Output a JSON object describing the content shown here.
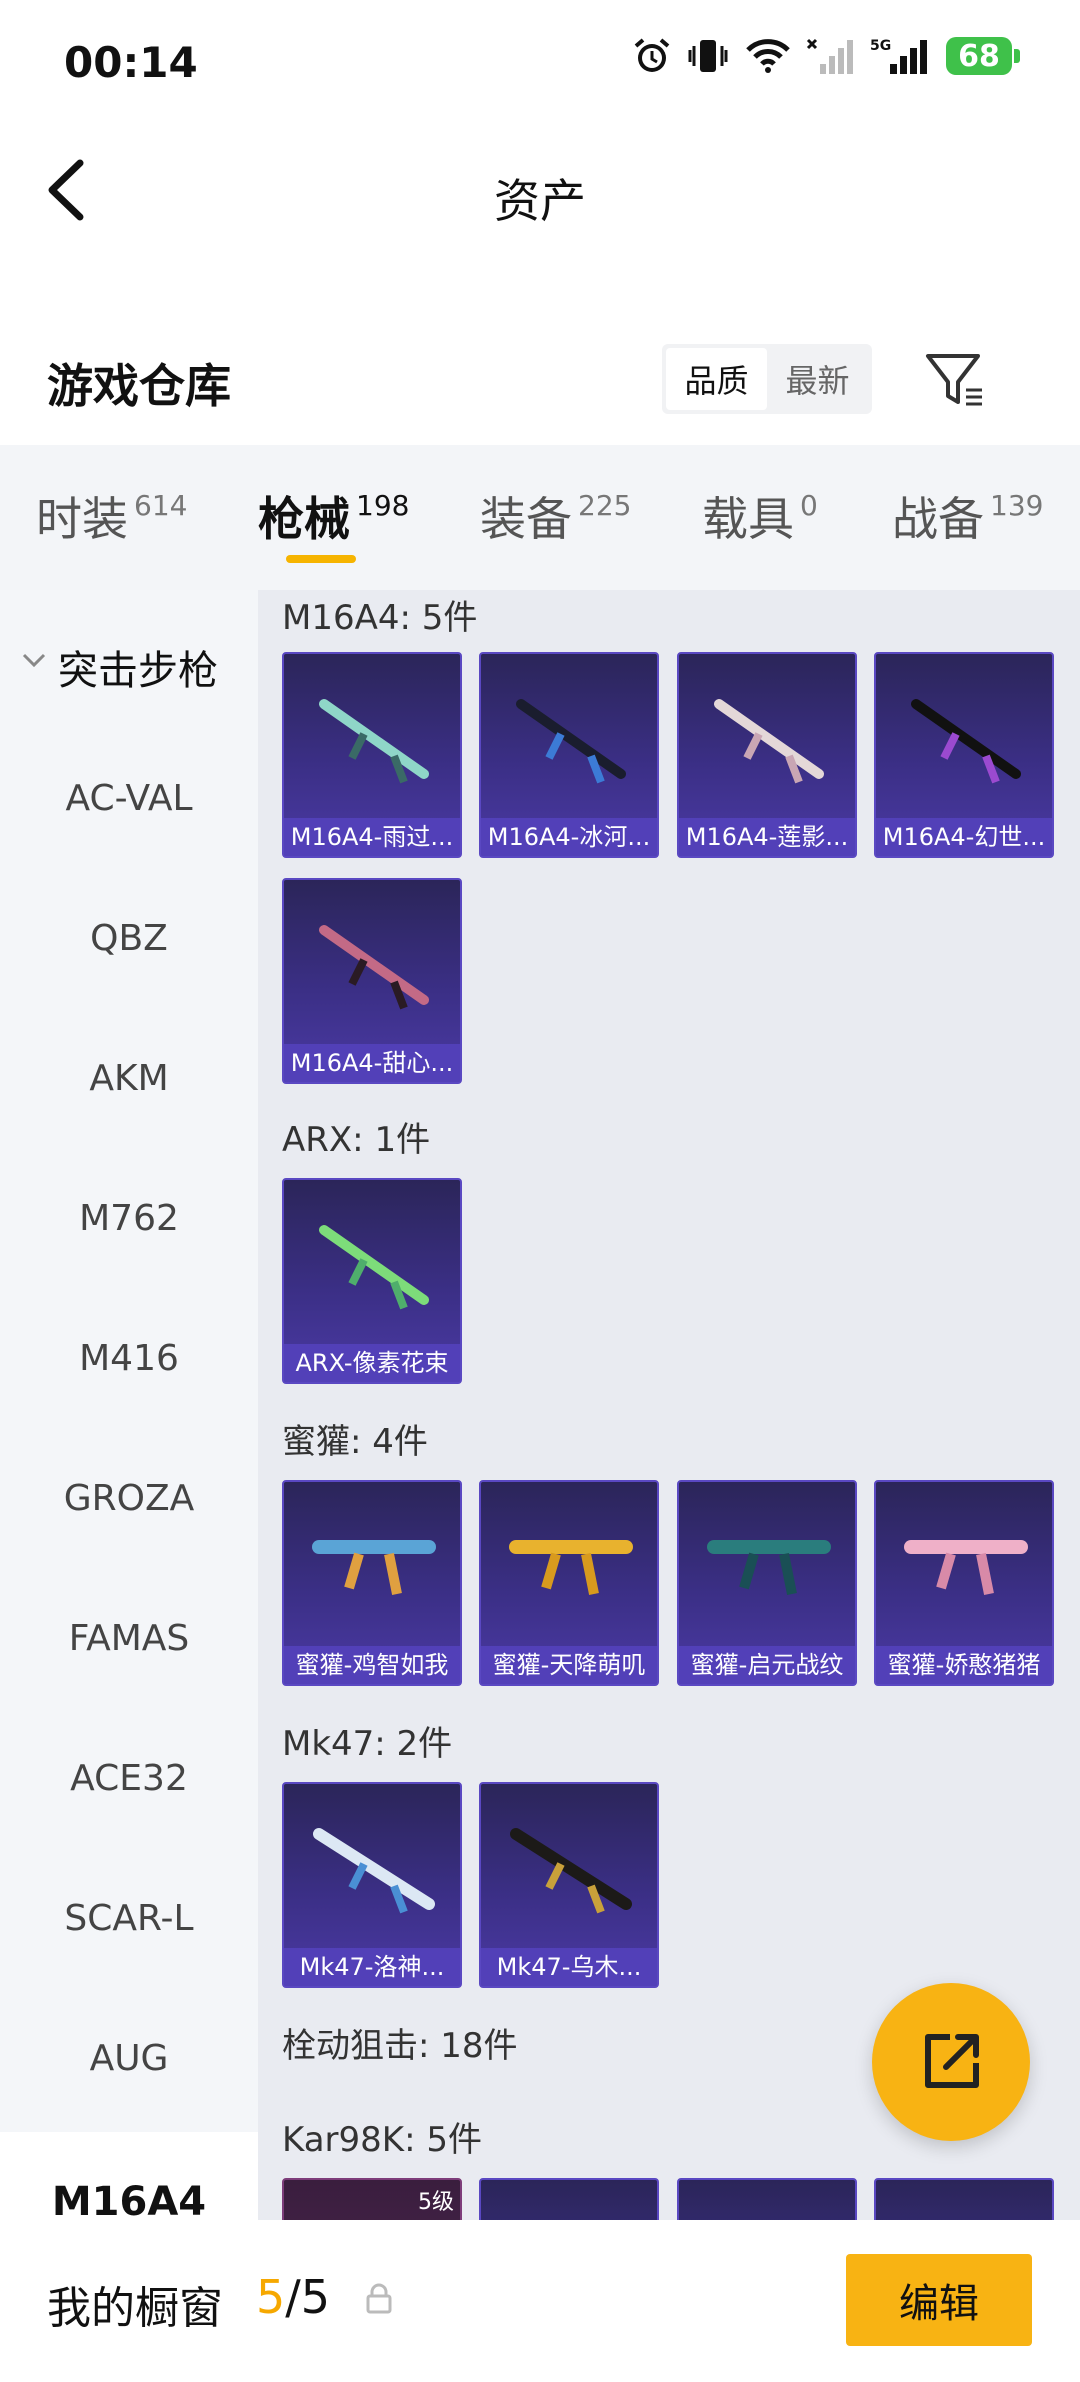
{
  "status_bar": {
    "time": "00:14",
    "network": "5G",
    "battery": "68"
  },
  "nav": {
    "title": "资产"
  },
  "section": {
    "title": "游戏仓库",
    "sort_options": [
      "品质",
      "最新"
    ],
    "active_sort": "品质"
  },
  "tabs": [
    {
      "label": "时装",
      "count": "614"
    },
    {
      "label": "枪械",
      "count": "198"
    },
    {
      "label": "装备",
      "count": "225"
    },
    {
      "label": "载具",
      "count": "0"
    },
    {
      "label": "战备",
      "count": "139"
    }
  ],
  "active_tab": "枪械",
  "sidebar": {
    "category": "突击步枪",
    "items": [
      "AC-VAL",
      "QBZ",
      "AKM",
      "M762",
      "M416",
      "GROZA",
      "FAMAS",
      "ACE32",
      "SCAR-L",
      "AUG",
      "M16A4"
    ],
    "selected": "M16A4"
  },
  "groups": [
    {
      "label": "M16A4: 5件",
      "items": [
        "M16A4-雨过...",
        "M16A4-冰河...",
        "M16A4-莲影...",
        "M16A4-幻世...",
        "M16A4-甜心..."
      ]
    },
    {
      "label": "ARX: 1件",
      "items": [
        "ARX-像素花束"
      ]
    },
    {
      "label": "蜜獾: 4件",
      "items": [
        "蜜獾-鸡智如我",
        "蜜獾-天降萌叽",
        "蜜獾-启元战纹",
        "蜜獾-娇憨猪猪"
      ]
    },
    {
      "label": "Mk47: 2件",
      "items": [
        "Mk47-洛神...",
        "Mk47-乌木..."
      ]
    },
    {
      "label": "栓动狙击: 18件",
      "items": []
    },
    {
      "label": "Kar98K: 5件",
      "items": []
    }
  ],
  "kar_first_level": "5级",
  "bottom": {
    "window_label": "我的橱窗",
    "current": "5",
    "total": "/5",
    "edit_label": "编辑"
  },
  "colors": {
    "accent": "#f8b313",
    "card_bg": "#3b2f86",
    "card_caption": "#5240b8"
  }
}
